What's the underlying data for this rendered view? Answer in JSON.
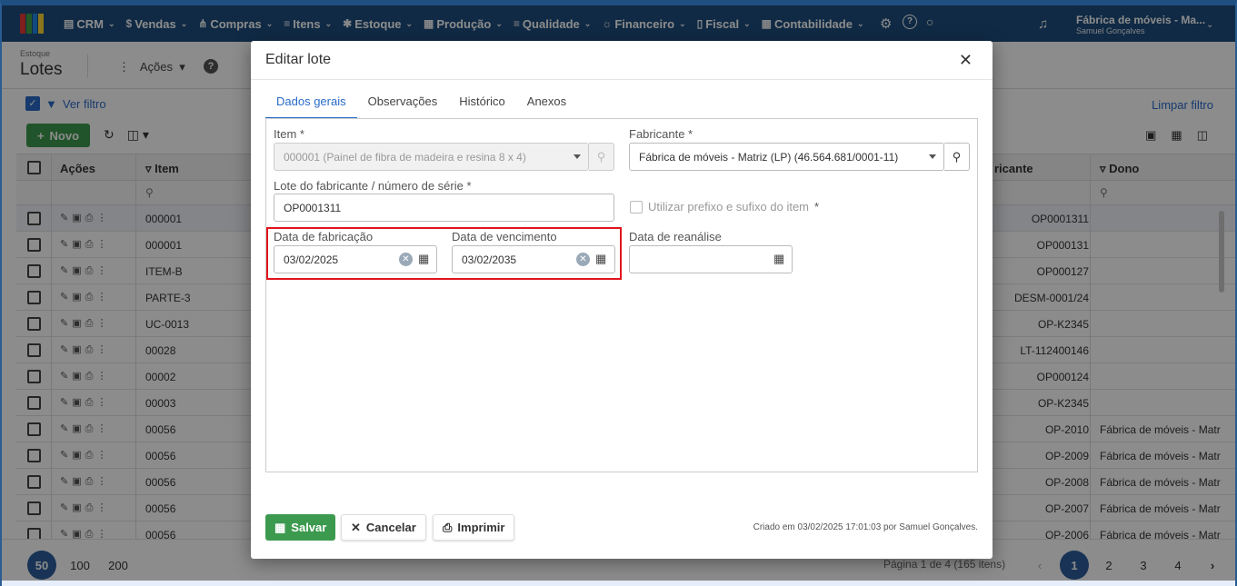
{
  "topbar": {
    "menu": [
      {
        "icon": "&#9636;",
        "label": "CRM"
      },
      {
        "icon": "$",
        "label": "Vendas"
      },
      {
        "icon": "&#8916;",
        "label": "Compras"
      },
      {
        "icon": "&#8801;",
        "label": "Itens"
      },
      {
        "icon": "&#10033;",
        "label": "Estoque"
      },
      {
        "icon": "&#9638;",
        "label": "Produção"
      },
      {
        "icon": "&#8801;",
        "label": "Qualidade"
      },
      {
        "icon": "&#9788;",
        "label": "Financeiro"
      },
      {
        "icon": "&#9647;",
        "label": "Fiscal"
      },
      {
        "icon": "&#9638;",
        "label": "Contabilidade"
      }
    ],
    "company_name": "Fábrica de móveis - Ma...",
    "user_name": "Samuel Gonçalves"
  },
  "page": {
    "breadcrumb": "Estoque",
    "title": "Lotes",
    "actions_label": "Ações",
    "filter_label": "Ver filtro",
    "clear_filter": "Limpar filtro",
    "new_button": "Novo"
  },
  "grid": {
    "headers": {
      "actions": "Ações",
      "item": "Item",
      "manufacturer": "ricante",
      "owner": "Dono"
    },
    "rows": [
      {
        "item": "000001",
        "manufacturer_lot": "OP0001311",
        "owner": ""
      },
      {
        "item": "000001",
        "manufacturer_lot": "OP000131",
        "owner": ""
      },
      {
        "item": "ITEM-B",
        "manufacturer_lot": "OP000127",
        "owner": ""
      },
      {
        "item": "PARTE-3",
        "manufacturer_lot": "DESM-0001/24",
        "owner": ""
      },
      {
        "item": "UC-0013",
        "manufacturer_lot": "OP-K2345",
        "owner": ""
      },
      {
        "item": "00028",
        "manufacturer_lot": "LT-112400146",
        "owner": ""
      },
      {
        "item": "00002",
        "manufacturer_lot": "OP000124",
        "owner": ""
      },
      {
        "item": "00003",
        "manufacturer_lot": "OP-K2345",
        "owner": ""
      },
      {
        "item": "00056",
        "manufacturer_lot": "OP-2010",
        "owner": "Fábrica de móveis - Matr"
      },
      {
        "item": "00056",
        "manufacturer_lot": "OP-2009",
        "owner": "Fábrica de móveis - Matr"
      },
      {
        "item": "00056",
        "manufacturer_lot": "OP-2008",
        "owner": "Fábrica de móveis - Matr"
      },
      {
        "item": "00056",
        "manufacturer_lot": "OP-2007",
        "owner": "Fábrica de móveis - Matr"
      },
      {
        "item": "00056",
        "manufacturer_lot": "OP-2006",
        "owner": "Fábrica de móveis - Matr"
      }
    ]
  },
  "pager": {
    "sizes": [
      "50",
      "100",
      "200"
    ],
    "info": "Página 1 de 4 (165 itens)",
    "pages": [
      "1",
      "2",
      "3",
      "4"
    ]
  },
  "modal": {
    "title": "Editar lote",
    "tabs": [
      "Dados gerais",
      "Observações",
      "Histórico",
      "Anexos"
    ],
    "item_label": "Item *",
    "item_value": "000001 (Painel de fibra de madeira e resina 8 x 4)",
    "manufacturer_label": "Fabricante *",
    "manufacturer_value": "Fábrica de móveis - Matriz (LP) (46.564.681/0001-11)",
    "lot_label": "Lote do fabricante / número de série *",
    "lot_value": "OP0001311",
    "prefix_label": "Utilizar prefixo e sufixo do item",
    "prefix_req": "*",
    "fab_date_label": "Data de fabricação",
    "fab_date_value": "03/02/2025",
    "exp_date_label": "Data de vencimento",
    "exp_date_value": "03/02/2035",
    "reanalysis_label": "Data de reanálise",
    "reanalysis_value": "",
    "save": "Salvar",
    "cancel": "Cancelar",
    "print": "Imprimir",
    "created": "Criado em 03/02/2025 17:01:03 por Samuel Gonçalves."
  },
  "colors": {
    "topbar": "#1e4e7e",
    "accent": "#2a6bc9",
    "green": "#3c9a4f",
    "highlight": "#e0141c"
  }
}
